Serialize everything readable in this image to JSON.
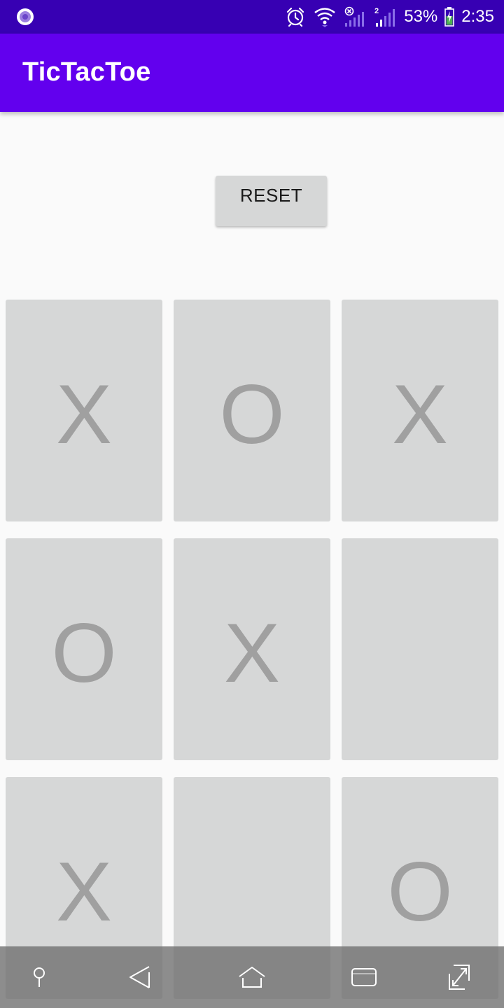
{
  "status_bar": {
    "left_icon": "app-notification-icon",
    "icons": [
      "alarm-icon",
      "wifi-icon",
      "signal-icon",
      "signal-2-icon",
      "battery-charging-icon"
    ],
    "battery": "53%",
    "time": "2:35"
  },
  "app_bar": {
    "title": "TicTacToe"
  },
  "reset_button": {
    "label": "RESET"
  },
  "board": {
    "rows": [
      [
        "X",
        "O",
        "X"
      ],
      [
        "O",
        "X",
        ""
      ],
      [
        "X",
        "",
        "O"
      ]
    ]
  },
  "nav_bar": {
    "icons": [
      "pin-icon",
      "back-icon",
      "home-icon",
      "recents-icon",
      "expand-icon"
    ]
  },
  "colors": {
    "status_bar": "#3700b3",
    "app_bar": "#6200ee",
    "cell": "#d6d7d7",
    "mark": "#a0a0a0",
    "background": "#fafafa"
  }
}
